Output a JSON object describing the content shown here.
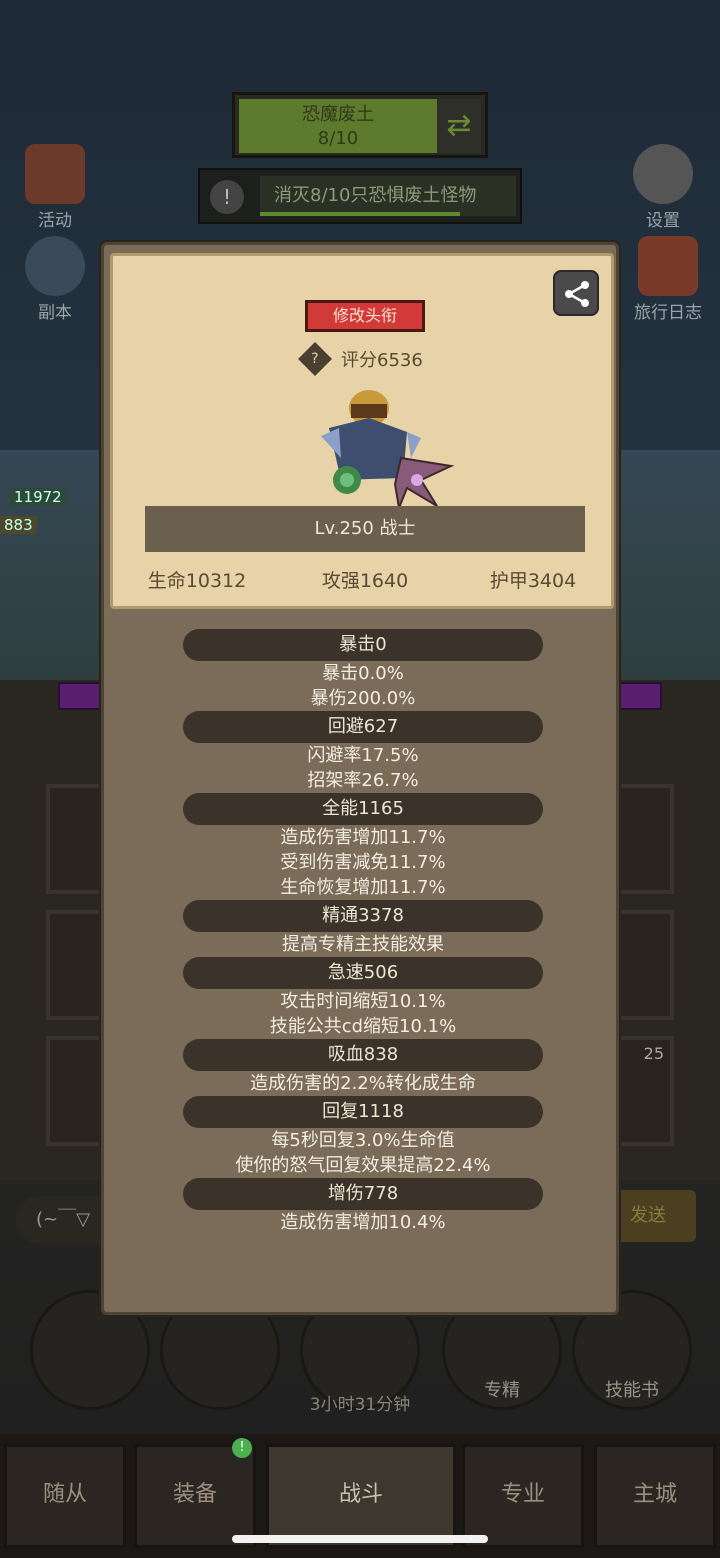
{
  "stage": {
    "name": "恐魔废土",
    "progress": "8/10"
  },
  "quest": {
    "text": "消灭8/10只恐惧废土怪物",
    "icon": "exclamation-icon"
  },
  "side_buttons": {
    "event": "活动",
    "dungeon": "副本",
    "settings": "设置",
    "journal": "旅行日志"
  },
  "battle_tags": {
    "hp_value": "11972",
    "hp_value2": "883"
  },
  "chat": {
    "placeholder": "(~￣▽",
    "send_label": "发送"
  },
  "card_badge": "25",
  "actions": {
    "specialization_label": "专精",
    "skillbook_label": "技能书",
    "timer": "3小时31分钟"
  },
  "nav": {
    "followers": "随从",
    "equipment": "装备",
    "battle": "战斗",
    "profession": "专业",
    "main_city": "主城",
    "badge": "!"
  },
  "profile": {
    "rename_label": "修改头衔",
    "score": "评分6536",
    "level_class": "Lv.250 战士",
    "hp": "生命10312",
    "attack": "攻强1640",
    "armor": "护甲3404"
  },
  "attributes": [
    {
      "title": "暴击0",
      "details": [
        "暴击0.0%",
        "暴伤200.0%"
      ]
    },
    {
      "title": "回避627",
      "details": [
        "闪避率17.5%",
        "招架率26.7%"
      ]
    },
    {
      "title": "全能1165",
      "details": [
        "造成伤害增加11.7%",
        "受到伤害减免11.7%",
        "生命恢复增加11.7%"
      ]
    },
    {
      "title": "精通3378",
      "details": [
        "提高专精主技能效果"
      ]
    },
    {
      "title": "急速506",
      "details": [
        "攻击时间缩短10.1%",
        "技能公共cd缩短10.1%"
      ]
    },
    {
      "title": "吸血838",
      "details": [
        "造成伤害的2.2%转化成生命"
      ]
    },
    {
      "title": "回复1118",
      "details": [
        "每5秒回复3.0%生命值",
        "使你的怒气回复效果提高22.4%"
      ]
    },
    {
      "title": "增伤778",
      "details": [
        "造成伤害增加10.4%"
      ]
    }
  ]
}
